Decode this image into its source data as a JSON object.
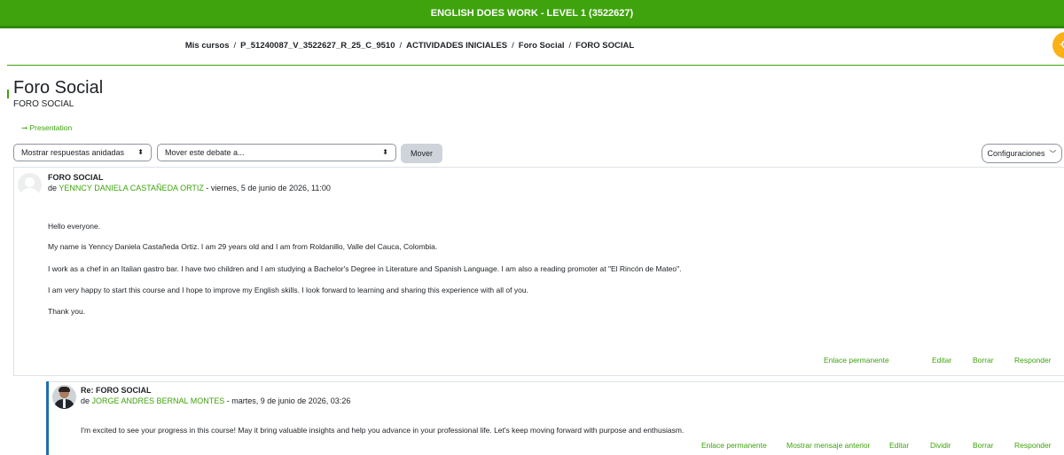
{
  "course_title": "ENGLISH DOES WORK - LEVEL 1 (3522627)",
  "breadcrumb": [
    "Mis cursos",
    "P_51240087_V_3522627_R_25_C_9510",
    "ACTIVIDADES INICIALES",
    "Foro Social",
    "FORO SOCIAL"
  ],
  "page": {
    "title": "Foro Social",
    "subtitle": "FORO SOCIAL",
    "presentation_link": "➞ Presentation"
  },
  "controls": {
    "display_mode": "Mostrar respuestas anidadas",
    "move_select": "Mover este debate a...",
    "move_button": "Mover",
    "settings_button": "Configuraciones"
  },
  "posts": [
    {
      "subject": "FORO SOCIAL",
      "by": "de",
      "author": "YENNCY DANIELA CASTAÑEDA ORTIZ",
      "date": " - viernes, 5 de junio de 2026, 11:00",
      "body": [
        "Hello everyone.",
        "My name is Yenncy Daniela Castañeda Ortiz. I am 29 years old and I am from Roldanillo, Valle del Cauca, Colombia.",
        "I work as a chef in an Italian gastro bar. I have two children and I am studying a Bachelor's Degree in Literature and Spanish Language. I am also a reading promoter at \"El Rincón de Mateo\".",
        "I am very happy to start this course and I hope to improve my English skills. I look forward to learning and sharing this experience with all of you.",
        "Thank you."
      ],
      "actions": [
        "Enlace permanente",
        "Editar",
        "Borrar",
        "Responder"
      ]
    },
    {
      "subject": "Re: FORO SOCIAL",
      "by": "de",
      "author": "JORGE ANDRES BERNAL MONTES",
      "date": " - martes, 9 de junio de 2026, 03:26",
      "body": [
        "I'm excited to see your progress in this course! May it bring valuable insights and help you advance in your professional life. Let's keep moving forward with purpose and enthusiasm."
      ],
      "actions": [
        "Enlace permanente",
        "Mostrar mensaje anterior",
        "Editar",
        "Dividir",
        "Borrar",
        "Responder"
      ]
    }
  ],
  "colors": {
    "brand_green": "#3ea30c",
    "reply_accent": "#1e6fa8",
    "help_orange": "#f9b116"
  }
}
